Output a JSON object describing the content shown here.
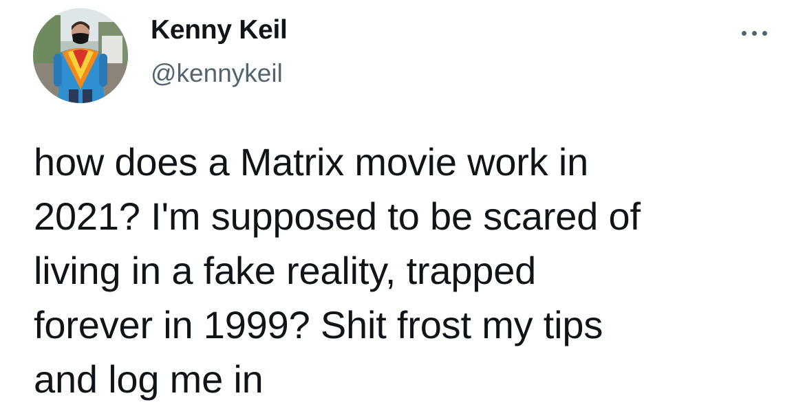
{
  "author": {
    "display_name": "Kenny Keil",
    "handle": "@kennykeil",
    "avatar_icon": "profile-photo"
  },
  "more_icon": "ellipsis-icon",
  "tweet": {
    "text_lines": [
      "how does a Matrix movie work in",
      "2021? I'm supposed to be scared of",
      "living in a fake reality, trapped",
      "forever in 1999? Shit frost my tips",
      "and log me in"
    ]
  },
  "colors": {
    "text": "#0f1419",
    "secondary_text": "#536471",
    "background": "#ffffff"
  }
}
